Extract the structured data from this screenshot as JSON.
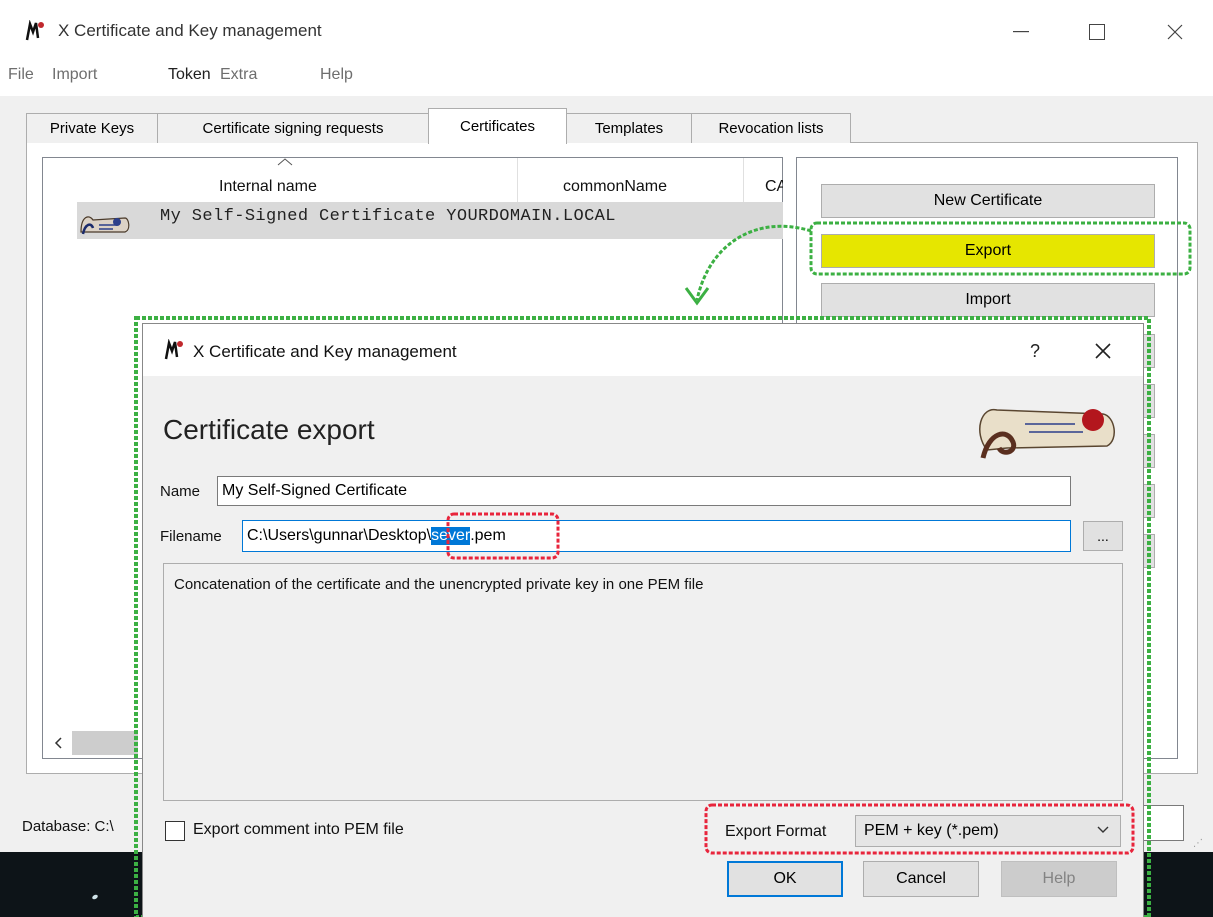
{
  "app": {
    "title": "X Certificate and Key management",
    "menu": [
      "File",
      "Import",
      "Token",
      "Extra",
      "Help"
    ],
    "active_menu_index": 2
  },
  "tabs": [
    {
      "label": "Private Keys",
      "selected": false
    },
    {
      "label": "Certificate signing requests",
      "selected": false
    },
    {
      "label": "Certificates",
      "selected": true
    },
    {
      "label": "Templates",
      "selected": false
    },
    {
      "label": "Revocation lists",
      "selected": false
    }
  ],
  "cert_list": {
    "columns": [
      "Internal name",
      "commonName",
      "CA"
    ],
    "rows": [
      {
        "text": "My Self-Signed Certificate YOURDOMAIN.LOCAL",
        "selected": true
      }
    ]
  },
  "side_buttons": {
    "new_certificate": "New Certificate",
    "export": "Export",
    "import": "Import",
    "export_highlight_color": "#e6e600"
  },
  "statusbar": {
    "database": "Database: C:\\"
  },
  "dialog": {
    "title": "X Certificate and Key management",
    "help_glyph": "?",
    "heading": "Certificate export",
    "name_label": "Name",
    "name_value": "My Self-Signed Certificate",
    "filename_label": "Filename",
    "filename_prefix": "C:\\Users\\gunnar\\Desktop\\",
    "filename_selected": "sever",
    "filename_suffix": ".pem",
    "browse_label": "...",
    "description": "Concatenation of the certificate and the unencrypted private key in one PEM file",
    "export_comment_label": "Export comment into PEM file",
    "export_comment_checked": false,
    "export_format_label": "Export Format",
    "export_format_value": "PEM + key (*.pem)",
    "ok_label": "OK",
    "cancel_label": "Cancel",
    "help_label": "Help"
  },
  "annotations": {
    "green_dash_color": "#3cb043",
    "red_dash_color": "#e8253c"
  }
}
